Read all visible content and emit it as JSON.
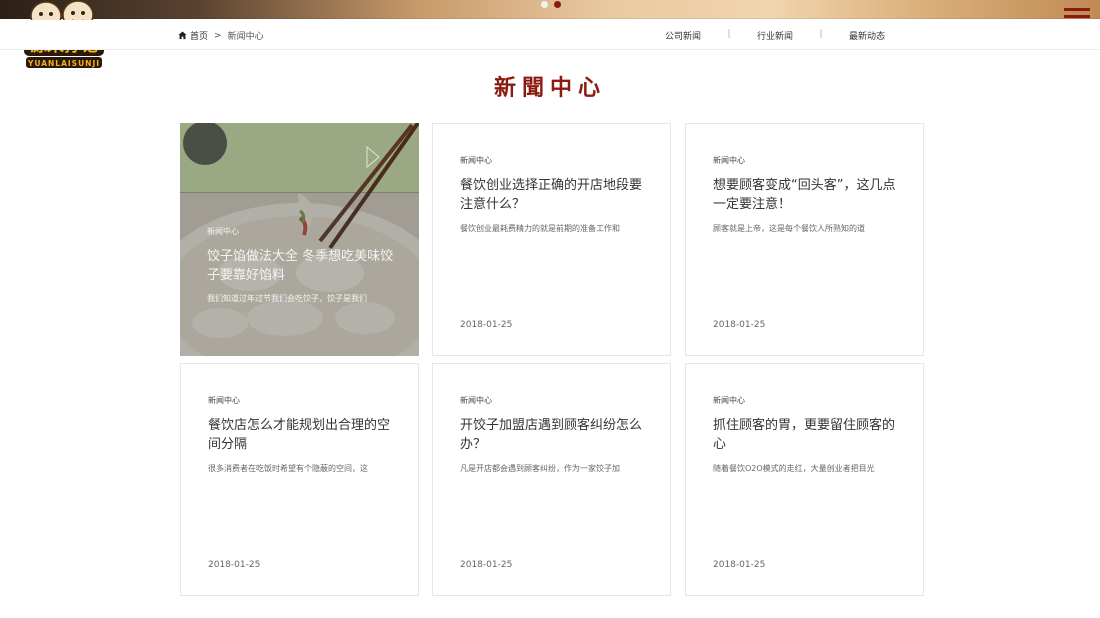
{
  "header": {
    "logo": {
      "name_cn": "源来孙记",
      "name_en": "YUANLAISUNJI"
    },
    "slider_dots": 2,
    "slider_active_index": 1,
    "menu_icon": "hamburger-icon"
  },
  "breadcrumb": {
    "home_icon": "home-icon",
    "home_label": "首页",
    "separator": ">",
    "current_label": "新闻中心"
  },
  "category_nav": {
    "items": [
      {
        "label": "公司新闻"
      },
      {
        "label": "行业新闻"
      },
      {
        "label": "最新动态"
      }
    ],
    "divider": "|"
  },
  "page": {
    "title": "新聞中心"
  },
  "colors": {
    "accent": "#8b1a10",
    "card_border": "#e6e6e6",
    "text": "#333333"
  },
  "news": [
    {
      "category": "新闻中心",
      "title": "饺子馅做法大全 冬季想吃美味饺子要靠好馅料",
      "excerpt": "我们知道过年过节我们会吃饺子，饺子是我们",
      "date": ""
    },
    {
      "category": "新闻中心",
      "title": "餐饮创业选择正确的开店地段要注意什么？",
      "excerpt": "餐饮创业最耗费精力的就是前期的准备工作和",
      "date": "2018-01-25"
    },
    {
      "category": "新闻中心",
      "title": "想要顾客变成“回头客”，这几点一定要注意！",
      "excerpt": "顾客就是上帝，这是每个餐饮人所熟知的道",
      "date": "2018-01-25"
    },
    {
      "category": "新闻中心",
      "title": "餐饮店怎么才能规划出合理的空间分隔",
      "excerpt": "很多消费者在吃饭时希望有个隐蔽的空间，这",
      "date": "2018-01-25"
    },
    {
      "category": "新闻中心",
      "title": "开饺子加盟店遇到顾客纠纷怎么办？",
      "excerpt": "凡是开店都会遇到顾客纠纷，作为一家饺子加",
      "date": "2018-01-25"
    },
    {
      "category": "新闻中心",
      "title": "抓住顾客的胃，更要留住顾客的心",
      "excerpt": "随着餐饮O2O模式的走红，大量创业者把目光",
      "date": "2018-01-25"
    }
  ]
}
